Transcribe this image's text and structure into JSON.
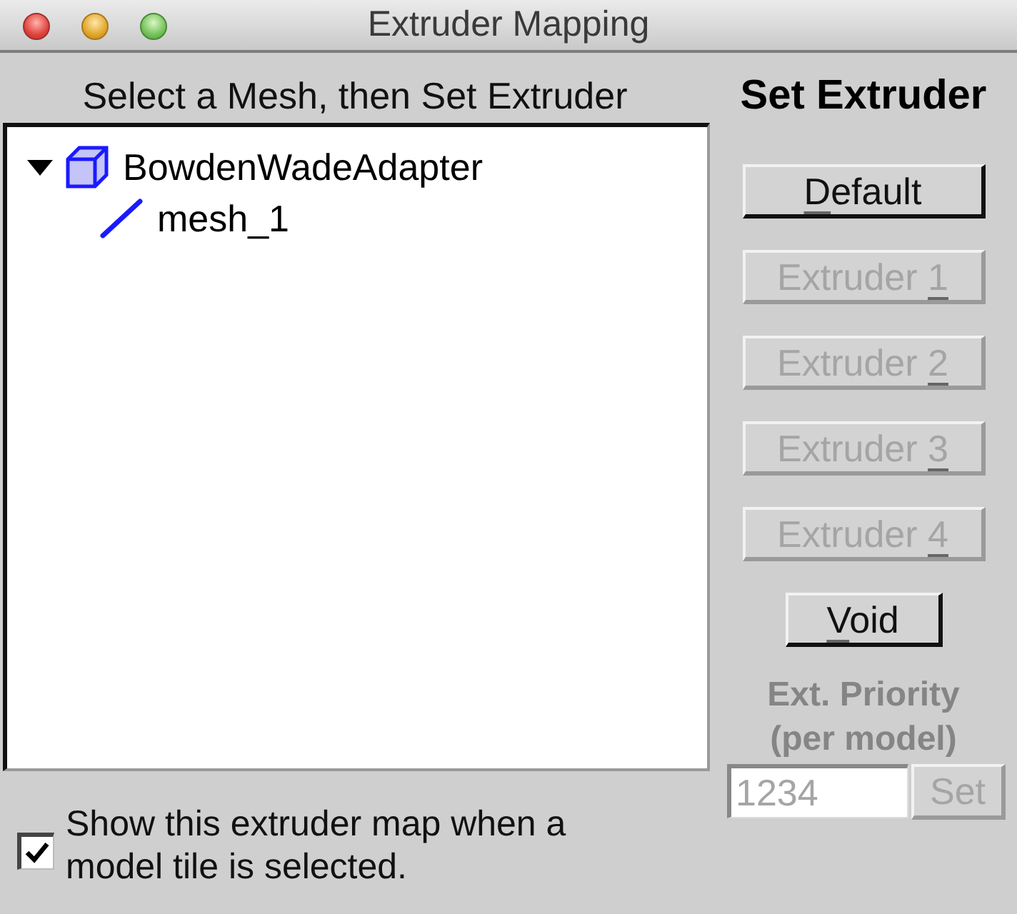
{
  "window": {
    "title": "Extruder Mapping"
  },
  "mesh_panel": {
    "heading": "Select a Mesh, then Set Extruder",
    "tree": [
      {
        "kind": "model",
        "label": "BowdenWadeAdapter",
        "expanded": true,
        "children": [
          {
            "kind": "mesh",
            "label": "mesh_1"
          }
        ]
      }
    ]
  },
  "show_map_option": {
    "label": "Show this extruder map when a model tile is selected.",
    "checked": true
  },
  "set_extruder": {
    "heading": "Set Extruder",
    "buttons": [
      {
        "label": "Default",
        "kind": "mnemonic_first",
        "disabled": false
      },
      {
        "label": "Extruder 1",
        "kind": "mnemonic_last",
        "disabled": true
      },
      {
        "label": "Extruder 2",
        "kind": "mnemonic_last",
        "disabled": true
      },
      {
        "label": "Extruder 3",
        "kind": "mnemonic_last",
        "disabled": true
      },
      {
        "label": "Extruder 4",
        "kind": "mnemonic_last",
        "disabled": true
      }
    ],
    "void_button": {
      "label": "Void",
      "kind": "mnemonic_first",
      "disabled": false
    }
  },
  "priority": {
    "label": "Ext. Priority (per model)",
    "value": "1234",
    "button": "Set",
    "disabled": true
  }
}
